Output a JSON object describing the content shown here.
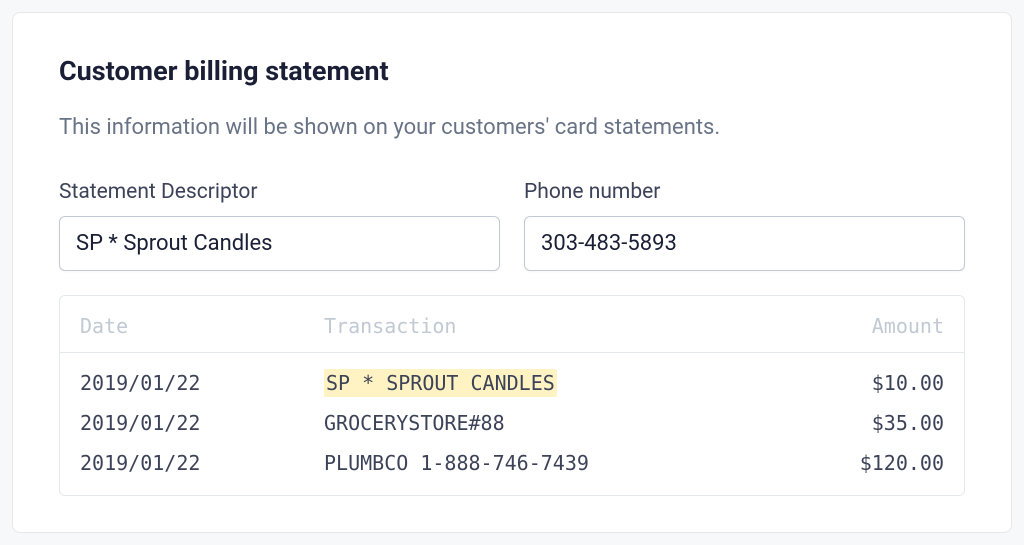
{
  "card": {
    "title": "Customer billing statement",
    "description": "This information will be shown on your customers' card statements."
  },
  "form": {
    "descriptor": {
      "label": "Statement Descriptor",
      "value": "SP * Sprout Candles"
    },
    "phone": {
      "label": "Phone number",
      "value": "303-483-5893"
    }
  },
  "statement": {
    "headers": {
      "date": "Date",
      "transaction": "Transaction",
      "amount": "Amount"
    },
    "rows": [
      {
        "date": "2019/01/22",
        "transaction": "SP * SPROUT CANDLES",
        "amount": "$10.00",
        "highlight": true
      },
      {
        "date": "2019/01/22",
        "transaction": "GROCERYSTORE#88",
        "amount": "$35.00",
        "highlight": false
      },
      {
        "date": "2019/01/22",
        "transaction": "PLUMBCO 1-888-746-7439",
        "amount": "$120.00",
        "highlight": false
      }
    ]
  }
}
